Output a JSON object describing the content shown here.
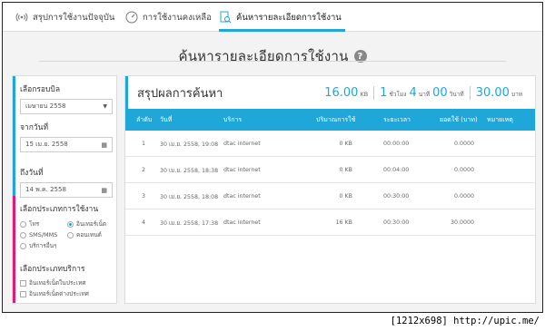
{
  "nav": {
    "tabs": [
      {
        "label": "สรุปการใช้งานปัจจุบัน",
        "icon": "signal-icon",
        "active": false
      },
      {
        "label": "การใช้งานคงเหลือ",
        "icon": "gauge-icon",
        "active": false
      },
      {
        "label": "ค้นหารายละเอียดการใช้งาน",
        "icon": "document-search-icon",
        "active": true
      }
    ]
  },
  "page": {
    "title": "ค้นหารายละเอียดการใช้งาน",
    "help_icon": "?"
  },
  "filters": {
    "billing_label": "เลือกรอบบิล",
    "billing_value": "เมษายน 2558",
    "from_label": "จากวันที่",
    "from_value": "15 เม.ย. 2558",
    "to_label": "ถึงวันที่",
    "to_value": "14 พ.ค. 2558",
    "type_label": "เลือกประเภทการใช้งาน",
    "types": [
      "โทร",
      "อินเทอร์เน็ต",
      "SMS/MMS",
      "คอนเทนต์",
      "บริการอื่นๆ"
    ],
    "selected_type": "อินเทอร์เน็ต",
    "service_label": "เลือกประเภทบริการ",
    "services": [
      "อินเทอร์เน็ตในประเทศ",
      "อินเทอร์เน็ตต่างประเทศ"
    ],
    "colors": {
      "billing": "#1fa7d9",
      "date": "#1fa7d9",
      "type": "#e0197d",
      "service": "#e0197d"
    }
  },
  "summary": {
    "title": "สรุปผลการค้นหา",
    "size_value": "16.00",
    "size_unit": "KB",
    "hours": "1",
    "hours_unit": "ชั่วโมง",
    "minutes": "4",
    "minutes_unit": "นาที",
    "seconds": "00",
    "seconds_unit": "วินาที",
    "cost_value": "30.00",
    "cost_unit": "บาท"
  },
  "table": {
    "headers": [
      "ลำดับ",
      "วันที่",
      "บริการ",
      "ปริมาณการใช้",
      "ระยะเวลา",
      "ยอดใช้ (บาท)",
      "หมายเหตุ"
    ],
    "rows": [
      {
        "no": "1",
        "date": "30 เม.ย. 2558, 19:08",
        "service": "dtac internet",
        "volume": "0 KB",
        "duration": "00:00:00",
        "amount": "0.0000",
        "note": ""
      },
      {
        "no": "2",
        "date": "30 เม.ย. 2558, 18:38",
        "service": "dtac internet",
        "volume": "0 KB",
        "duration": "00:04:00",
        "amount": "0.0000",
        "note": ""
      },
      {
        "no": "3",
        "date": "30 เม.ย. 2558, 18:08",
        "service": "dtac internet",
        "volume": "0 KB",
        "duration": "00:30:00",
        "amount": "0.0000",
        "note": ""
      },
      {
        "no": "4",
        "date": "30 เม.ย. 2558, 17:38",
        "service": "dtac internet",
        "volume": "16 KB",
        "duration": "00:30:00",
        "amount": "30.0000",
        "note": ""
      }
    ]
  },
  "watermark": "[1212x698] http://upic.me/",
  "accent": "#1fa7d9"
}
